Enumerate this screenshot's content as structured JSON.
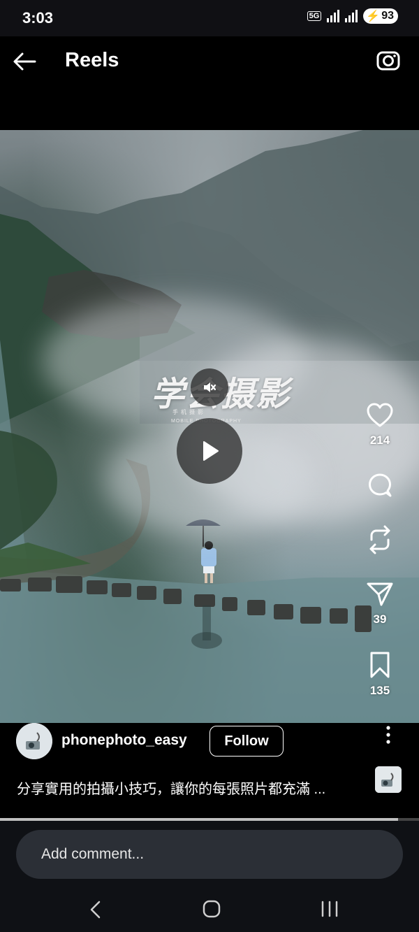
{
  "status_bar": {
    "time": "3:03",
    "network": "5G",
    "battery": "93"
  },
  "header": {
    "title": "Reels",
    "back_icon": "arrow-left-icon",
    "camera_icon": "camera-icon"
  },
  "video_overlay": {
    "title": "学会摄影",
    "subtitle_cn": "手机摄影",
    "subtitle_en": "MOBILE PHOTOGRAPHY",
    "mute_icon": "volume-off-icon",
    "play_icon": "play-icon"
  },
  "actions": {
    "like": {
      "icon": "heart-icon",
      "count": "214"
    },
    "comment": {
      "icon": "comment-bubble-icon"
    },
    "repost": {
      "icon": "repost-icon"
    },
    "share": {
      "icon": "paper-plane-icon",
      "count": "39"
    },
    "save": {
      "icon": "bookmark-icon",
      "count": "135"
    }
  },
  "post": {
    "username": "phonephoto_easy",
    "follow_label": "Follow",
    "caption": "分享實用的拍攝小技巧，讓你的每張照片都充滿 ..."
  },
  "progress": {
    "played": 0.95
  },
  "comment": {
    "placeholder": "Add comment..."
  },
  "colors": {
    "background": "#000000",
    "input_bg": "#2b2f36",
    "accent": "#ffffff"
  }
}
